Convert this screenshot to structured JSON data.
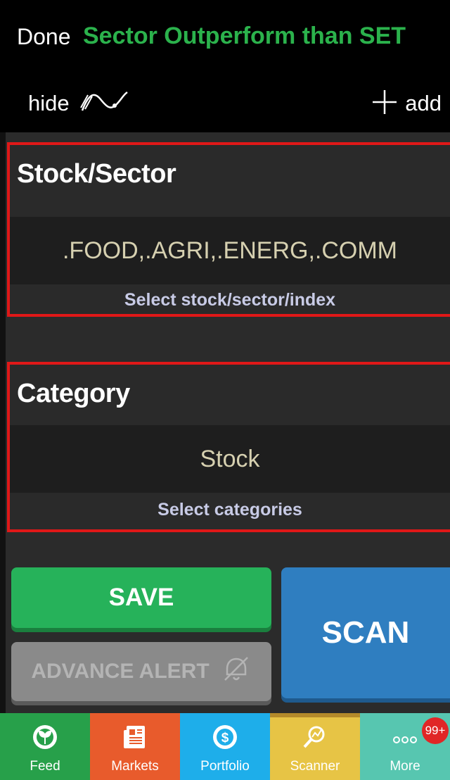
{
  "header": {
    "done_label": "Done",
    "title": "Sector Outperform than SET",
    "hide_label": "hide",
    "add_label": "add",
    "title_color": "#2bb24c"
  },
  "stock_sector": {
    "heading": "Stock/Sector",
    "value": ".FOOD,.AGRI,.ENERG,.COMM",
    "hint": "Select stock/sector/index"
  },
  "category": {
    "heading": "Category",
    "value": "Stock",
    "hint": "Select categories"
  },
  "actions": {
    "save_label": "SAVE",
    "advance_alert_label": "ADVANCE ALERT",
    "scan_label": "SCAN"
  },
  "tabbar": {
    "feed": "Feed",
    "markets": "Markets",
    "portfolio": "Portfolio",
    "scanner": "Scanner",
    "more": "More",
    "more_badge": "99+"
  },
  "colors": {
    "highlight_border": "#e01818",
    "save": "#26b25a",
    "scan": "#2f7ec0",
    "alert_disabled": "#8a8a8a"
  }
}
